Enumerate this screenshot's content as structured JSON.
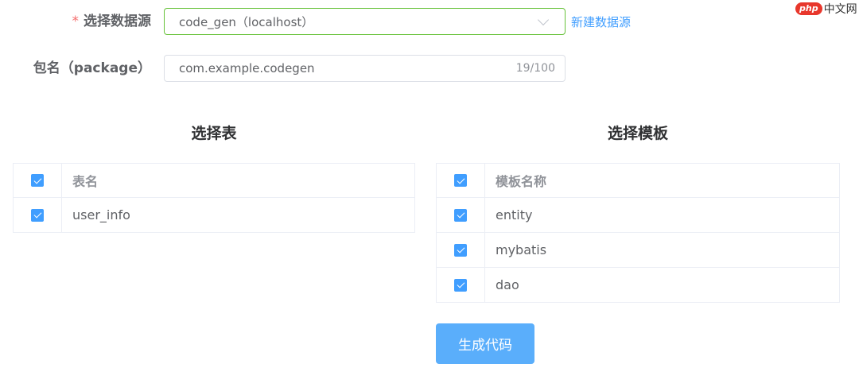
{
  "form": {
    "datasource": {
      "required_mark": "*",
      "label": "选择数据源",
      "value": "code_gen（localhost）",
      "new_link": "新建数据源"
    },
    "package": {
      "label": "包名（package）",
      "value": "com.example.codegen",
      "counter": "19/100"
    }
  },
  "tables": {
    "title": "选择表",
    "header": "表名",
    "rows": [
      "user_info"
    ]
  },
  "templates": {
    "title": "选择模板",
    "header": "模板名称",
    "rows": [
      "entity",
      "mybatis",
      "dao"
    ]
  },
  "actions": {
    "generate_label": "生成代码"
  },
  "watermark": {
    "logo": "php",
    "text": "中文网"
  },
  "colors": {
    "primary": "#409eff",
    "success_border": "#67c23a",
    "required": "#f56c6c"
  }
}
